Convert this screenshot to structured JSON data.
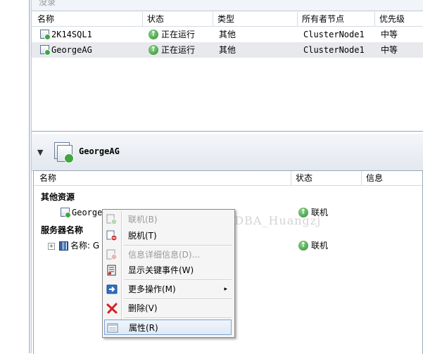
{
  "top": {
    "title": "没录",
    "columns": [
      "名称",
      "状态",
      "类型",
      "所有者节点",
      "优先级"
    ],
    "rows": [
      {
        "name": "2K14SQL1",
        "status": "正在运行",
        "type": "其他",
        "owner": "ClusterNode1",
        "priority": "中等"
      },
      {
        "name": "GeorgeAG",
        "status": "正在运行",
        "type": "其他",
        "owner": "ClusterNode1",
        "priority": "中等"
      }
    ]
  },
  "bottom": {
    "title": "GeorgeAG",
    "columns": [
      "名称",
      "状态",
      "信息"
    ],
    "group1": "其他资源",
    "res_name": "GeorgeA",
    "res_status": "联机",
    "group2": "服务器名称",
    "server_name": "名称: G",
    "server_status": "联机"
  },
  "watermark": "http://blog.csdn.net/DBA_Huangzj",
  "menu": {
    "items": [
      {
        "label": "联机(B)",
        "disabled": true
      },
      {
        "label": "脱机(T)",
        "disabled": false
      },
      {
        "label": "信息详细信息(D)...",
        "disabled": true
      },
      {
        "label": "显示关键事件(W)",
        "disabled": false
      },
      {
        "label": "更多操作(M)",
        "disabled": false
      },
      {
        "label": "删除(V)",
        "disabled": false
      },
      {
        "label": "属性(R)",
        "disabled": false
      }
    ],
    "submenu_arrow": "▸"
  },
  "colors": {
    "accent": "#7da2ce",
    "status_green": "#3fa63f",
    "delete_red": "#d62020"
  }
}
